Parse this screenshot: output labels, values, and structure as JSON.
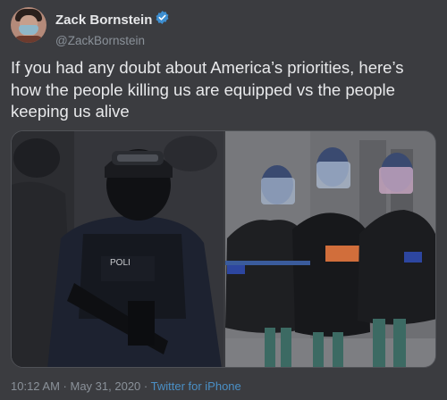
{
  "author": {
    "display_name": "Zack Bornstein",
    "handle": "@ZackBornstein",
    "verified": true
  },
  "tweet": {
    "text": "If you had any doubt about America’s priorities, here’s how the people killing us are equipped vs the people keeping us alive"
  },
  "media": {
    "photos": [
      {
        "icon": "police-officer-photo"
      },
      {
        "icon": "healthcare-workers-photo"
      }
    ]
  },
  "footer": {
    "time": "10:12 AM",
    "separator": " · ",
    "date": "May 31, 2020",
    "source": "Twitter for iPhone"
  },
  "colors": {
    "background": "#3b3c40",
    "link": "#4a8fc5",
    "verified_badge": "#3d8ed0",
    "muted_text": "#8a9199"
  }
}
